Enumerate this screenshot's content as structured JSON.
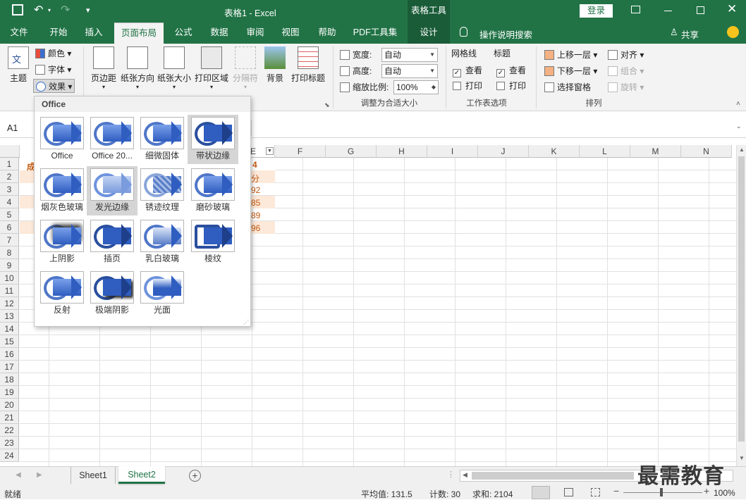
{
  "titlebar": {
    "doc_title": "表格1 - Excel",
    "context_title": "表格工具",
    "login_label": "登录"
  },
  "tabs": [
    {
      "label": "文件"
    },
    {
      "label": "开始"
    },
    {
      "label": "插入"
    },
    {
      "label": "页面布局"
    },
    {
      "label": "公式"
    },
    {
      "label": "数据"
    },
    {
      "label": "审阅"
    },
    {
      "label": "视图"
    },
    {
      "label": "帮助"
    },
    {
      "label": "PDF工具集"
    },
    {
      "label": "设计"
    }
  ],
  "tellme": "操作说明搜索",
  "share": "共享",
  "ribbon": {
    "theme": {
      "main": "主题",
      "colors": "颜色",
      "fonts": "字体",
      "effects": "效果"
    },
    "page_setup": {
      "margins": "页边距",
      "orientation": "纸张方向",
      "size": "纸张大小",
      "print_area": "打印区域",
      "breaks": "分隔符",
      "background": "背景",
      "print_titles": "打印标题"
    },
    "scale": {
      "width_label": "宽度:",
      "width_value": "自动",
      "height_label": "高度:",
      "height_value": "自动",
      "scale_label": "缩放比例:",
      "scale_value": "100%",
      "group": "调整为合适大小"
    },
    "sheet_options": {
      "gridlines": "网格线",
      "headings": "标题",
      "view": "查看",
      "print": "打印",
      "group": "工作表选项"
    },
    "arrange": {
      "bring_forward": "上移一层",
      "send_backward": "下移一层",
      "selection_pane": "选择窗格",
      "align": "对齐",
      "group_objs": "组合",
      "rotate": "旋转",
      "group": "排列"
    }
  },
  "formula_bar": {
    "name_box": "A1"
  },
  "grid": {
    "columns": [
      "F",
      "G",
      "H",
      "I",
      "J",
      "K",
      "L",
      "M",
      "N"
    ],
    "rows": [
      "1",
      "2",
      "3",
      "4",
      "5",
      "6",
      "7",
      "8",
      "9",
      "10",
      "11",
      "12",
      "13",
      "14",
      "15",
      "16",
      "17",
      "18",
      "19",
      "20",
      "21",
      "22",
      "23",
      "24"
    ],
    "peek_cells": [
      "4",
      "分",
      "92",
      "85",
      "89",
      "96"
    ],
    "peek_a1": "成"
  },
  "effects_panel": {
    "header": "Office",
    "items": [
      {
        "label": "Office"
      },
      {
        "label": "Office 20..."
      },
      {
        "label": "细微固体"
      },
      {
        "label": "带状边缘"
      },
      {
        "label": "烟灰色玻璃"
      },
      {
        "label": "发光边缘"
      },
      {
        "label": "锈迹纹理"
      },
      {
        "label": "磨砂玻璃"
      },
      {
        "label": "上阴影"
      },
      {
        "label": "插页"
      },
      {
        "label": "乳白玻璃"
      },
      {
        "label": "棱纹"
      },
      {
        "label": "反射"
      },
      {
        "label": "极端阴影"
      },
      {
        "label": "光面"
      }
    ]
  },
  "sheets": {
    "tab1": "Sheet1",
    "tab2": "Sheet2"
  },
  "status": {
    "ready": "就绪",
    "average": "平均值: 131.5",
    "count": "计数: 30",
    "sum": "求和: 2104",
    "zoom": "100%"
  },
  "watermark": "最需教育"
}
